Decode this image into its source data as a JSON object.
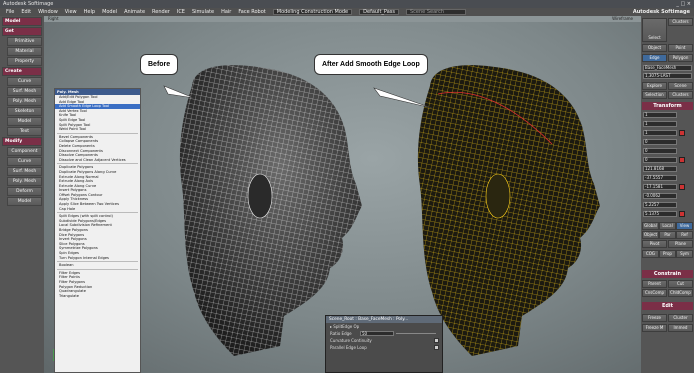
{
  "app": {
    "title": "Autodesk Softimage",
    "brand": "Autodesk Softimage",
    "window_controls": "_ □ ×"
  },
  "menubar": {
    "items": [
      "File",
      "Edit",
      "Window",
      "View",
      "Help",
      "Model",
      "Animate",
      "Render",
      "ICE",
      "Simulate",
      "Hair",
      "Face Robot"
    ],
    "layout_field": "Modeling Construction Mode",
    "scene_field": "Default_Pass",
    "search_placeholder": "Scene Search"
  },
  "left_toolbar": {
    "items": [
      {
        "label": "Model",
        "kind": "header"
      },
      {
        "label": "Get",
        "kind": "header"
      },
      {
        "label": "Primitive",
        "kind": "sub"
      },
      {
        "label": "Material",
        "kind": "sub"
      },
      {
        "label": "Property",
        "kind": "sub"
      },
      {
        "label": "Create",
        "kind": "header"
      },
      {
        "label": "Curve",
        "kind": "sub"
      },
      {
        "label": "Surf. Mesh",
        "kind": "sub"
      },
      {
        "label": "Poly. Mesh",
        "kind": "sub"
      },
      {
        "label": "Skeleton",
        "kind": "sub"
      },
      {
        "label": "Model",
        "kind": "sub"
      },
      {
        "label": "Text",
        "kind": "sub"
      },
      {
        "label": "Modify",
        "kind": "header"
      },
      {
        "label": "Component",
        "kind": "sub"
      },
      {
        "label": "Curve",
        "kind": "sub"
      },
      {
        "label": "Surf. Mesh",
        "kind": "sub"
      },
      {
        "label": "Poly. Mesh",
        "kind": "sub"
      },
      {
        "label": "Deform",
        "kind": "sub"
      },
      {
        "label": "Model",
        "kind": "sub"
      }
    ]
  },
  "viewport": {
    "header": "Right",
    "mode": "Wireframe",
    "callout_before": "Before",
    "callout_after": "After Add Smooth Edge Loop"
  },
  "poly_menu": {
    "title": "Poly. Mesh",
    "items": [
      {
        "label": "Add/Edit Polygon Tool"
      },
      {
        "label": "Add Edge Tool"
      },
      {
        "label": "Add Smooth Edge Loop Tool",
        "selected": true
      },
      {
        "label": "Add Vertex Tool"
      },
      {
        "label": "Knife Tool"
      },
      {
        "label": "Split Edge Tool"
      },
      {
        "label": "Split Polygon Tool"
      },
      {
        "label": "Weld Point Tool"
      },
      {
        "sep": true
      },
      {
        "label": "Bevel Components"
      },
      {
        "label": "Collapse Components"
      },
      {
        "label": "Delete Components"
      },
      {
        "label": "Disconnect Components"
      },
      {
        "label": "Dissolve Components"
      },
      {
        "label": "Dissolve and Clean Adjacent Vertices"
      },
      {
        "sep": true
      },
      {
        "label": "Duplicate Polygons"
      },
      {
        "label": "Duplicate Polygons Along Curve"
      },
      {
        "label": "Extrude Along Normal"
      },
      {
        "label": "Extrude Along Axis"
      },
      {
        "label": "Extrude Along Curve"
      },
      {
        "label": "Insert Polygons"
      },
      {
        "label": "Offset Polygons Contour"
      },
      {
        "label": "Apply Thickness"
      },
      {
        "label": "Apply Slice Between Two Vertices"
      },
      {
        "label": "Cap Hole"
      },
      {
        "sep": true
      },
      {
        "label": "Split Edges (with split control)"
      },
      {
        "label": "Subdivide Polygons/Edges"
      },
      {
        "label": "Local Subdivision Refinement"
      },
      {
        "label": "Bridge Polygons"
      },
      {
        "label": "Dice Polygons"
      },
      {
        "label": "Invert Polygons"
      },
      {
        "label": "Slice Polygons"
      },
      {
        "label": "Symmetrize Polygons"
      },
      {
        "label": "Spin Edges"
      },
      {
        "label": "Turn Polygon Internal Edges"
      },
      {
        "sep": true
      },
      {
        "label": "Boolean"
      },
      {
        "sep": true
      },
      {
        "label": "Filter Edges"
      },
      {
        "label": "Filter Points"
      },
      {
        "label": "Filter Polygons"
      },
      {
        "label": "Polygon Reduction"
      },
      {
        "label": "Quadrangulate"
      },
      {
        "label": "Triangulate"
      }
    ]
  },
  "property_page": {
    "title": "Scene_Root : Base_FaceMesh : Poly...",
    "section": "SplitEdge Op",
    "rows": [
      {
        "label": "Ratio Edge",
        "value": "50"
      },
      {
        "label": "Curvature Continuity",
        "value": ""
      },
      {
        "label": "Parallel Edge Loop",
        "value": ""
      }
    ]
  },
  "right_panel": {
    "top_buttons": [
      "Select",
      "Clusters",
      "Object",
      "Point",
      "Edge",
      "Polygon"
    ],
    "search_field": "Base_FaceMesh",
    "selection_field": "1,3075-LAST",
    "explore_buttons": [
      "Explore",
      "Scene",
      "Selection",
      "Clusters"
    ],
    "transform_header": "Transform",
    "transform_values": [
      "1",
      "1",
      "1",
      "0",
      "0",
      "0",
      "121.8168",
      "-37.5557",
      "-17.1581",
      "-0.0062",
      "5.2257",
      "5.1375"
    ],
    "mode_buttons": [
      "Global",
      "Local",
      "View",
      "Object",
      "Par",
      "Ref",
      "Pivot",
      "Plane"
    ],
    "snap_buttons": [
      "COG",
      "Prop",
      "Sym"
    ],
    "constrain_header": "Constrain",
    "constrain_buttons": [
      "Parent",
      "Cut",
      "CnsComp",
      "ChldComp"
    ],
    "edit_header": "Edit",
    "edit_buttons": [
      "Freeze",
      "Cluster",
      "Freeze M",
      "Immed"
    ]
  }
}
